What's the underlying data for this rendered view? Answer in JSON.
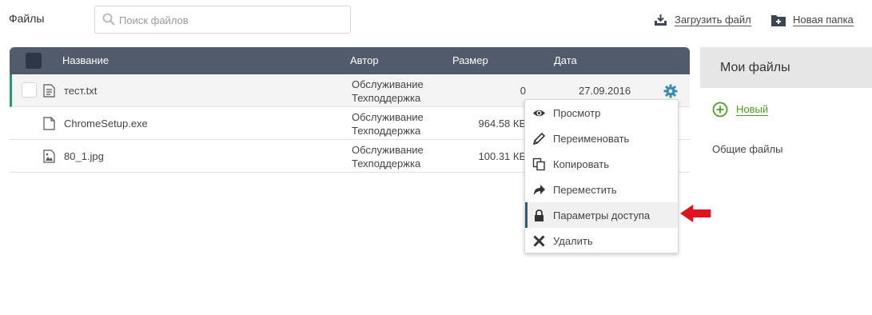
{
  "page": {
    "title": "Файлы"
  },
  "search": {
    "placeholder": "Поиск файлов",
    "value": ""
  },
  "toolbar": {
    "upload_label": "Загрузить файл",
    "new_folder_label": "Новая папка"
  },
  "table": {
    "columns": [
      "Название",
      "Автор",
      "Размер",
      "Дата"
    ],
    "rows": [
      {
        "name": "тест.txt",
        "icon": "text-file-icon",
        "author_line1": "Обслуживание",
        "author_line2": "Техподдержка",
        "size": "0",
        "date": "27.09.2016",
        "selected": true
      },
      {
        "name": "ChromeSetup.exe",
        "icon": "file-icon",
        "author_line1": "Обслуживание",
        "author_line2": "Техподдержка",
        "size": "964.58 КБ",
        "date": ""
      },
      {
        "name": "80_1.jpg",
        "icon": "image-file-icon",
        "author_line1": "Обслуживание",
        "author_line2": "Техподдержка",
        "size": "100.31 КБ",
        "date": ""
      }
    ]
  },
  "context_menu": {
    "items": [
      {
        "label": "Просмотр",
        "icon": "eye-icon"
      },
      {
        "label": "Переименовать",
        "icon": "pencil-icon"
      },
      {
        "label": "Копировать",
        "icon": "copy-icon"
      },
      {
        "label": "Переместить",
        "icon": "move-arrow-icon"
      },
      {
        "label": "Параметры доступа",
        "icon": "lock-icon",
        "active": true
      },
      {
        "label": "Удалить",
        "icon": "delete-x-icon"
      }
    ]
  },
  "sidebar": {
    "title": "Мои файлы",
    "new_label": "Новый",
    "shared_label": "Общие файлы"
  },
  "colors": {
    "header_bg": "#525b6b",
    "accent_green": "#4d9a2a",
    "gear_blue": "#3d8fb0",
    "annotation_red": "#e0141e"
  }
}
